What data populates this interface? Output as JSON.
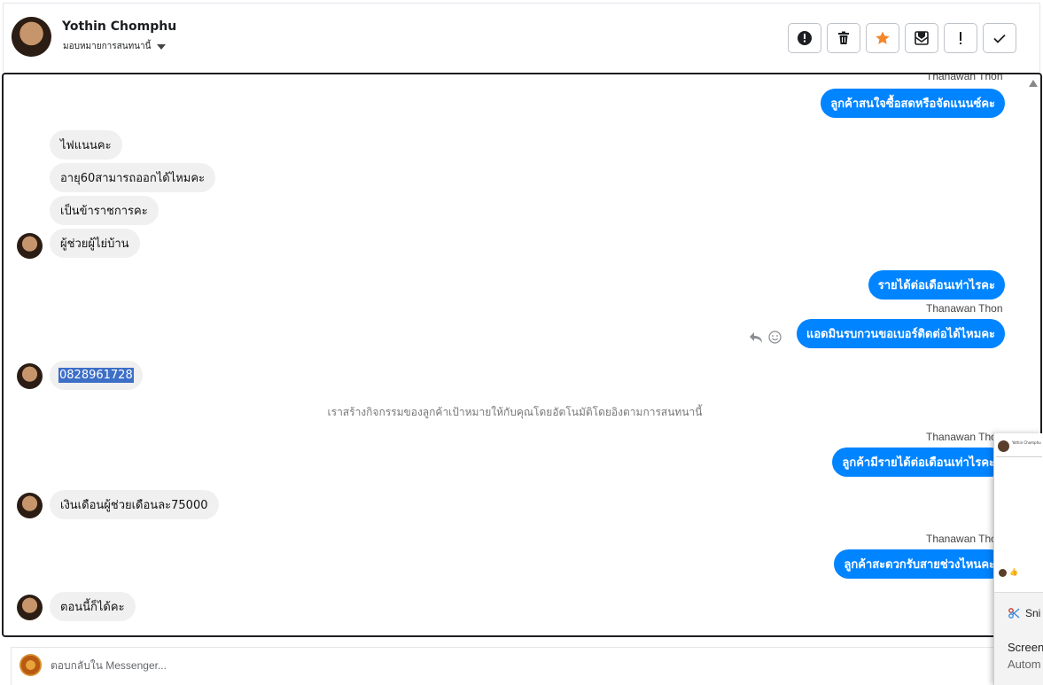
{
  "header": {
    "name": "Yothin Chomphu",
    "assign_label": "มอบหมายการสนทนานี้"
  },
  "actions": [
    {
      "icon": "alert-circle-icon"
    },
    {
      "icon": "trash-icon"
    },
    {
      "icon": "star-icon",
      "color": "#f5862a"
    },
    {
      "icon": "mail-icon"
    },
    {
      "icon": "exclamation-icon"
    },
    {
      "icon": "check-icon"
    }
  ],
  "messages": {
    "sender_name": "Thanawan Thon",
    "out1": "ลูกค้าสนใจซื้อสดหรือจัดแนนซ์คะ",
    "in1": "ไฟแนนคะ",
    "in2": "อายุ60สามารถออกได้ไหมคะ",
    "in3": "เป็นข้าราชการคะ",
    "in4": "ผู้ช่วยผู้ไย่บ้าน",
    "out2": "รายได้ต่อเดือนเท่าไรคะ",
    "out3": "แอดมินรบกวนขอเบอร์ติดต่อได้ไหมคะ",
    "in5": "0828961728",
    "system": "เราสร้างกิจกรรมของลูกค้าเป้าหมายให้กับคุณโดยอัตโนมัติโดยอิงตามการสนทนานี้",
    "out4": "ลูกค้ามีรายได้ต่อเดือนเท่าไรคะ",
    "in6": "เงินเดือนผู้ช่วยเดือนละ75000",
    "out5": "ลูกค้าสะดวกรับสายช่วงไหนคะ",
    "in7": "ตอนนี้ก็ได้คะ"
  },
  "reply": {
    "placeholder": "ตอบกลับใน Messenger..."
  },
  "overlay": {
    "thumb_name": "Yothin Chomphu",
    "snip_label": "Sni",
    "screen_label": "Screen",
    "auto_label": "Autom"
  },
  "colors": {
    "outgoing_bubble": "#0084ff",
    "incoming_bubble": "#f0f0f0",
    "selection": "#3d6fc7"
  }
}
